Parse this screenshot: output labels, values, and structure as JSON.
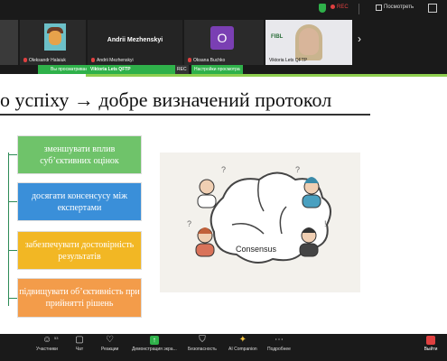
{
  "top_bar": {
    "rec_label": "REC",
    "view_label": "Посмотреть"
  },
  "participants": [
    {
      "name": "Oleksandr Halaiuk"
    },
    {
      "name": "Andrii Mezhenskyi",
      "display_name": "Andrii Mezhenskyi"
    },
    {
      "name": "Oksana Buchko",
      "initial": "O"
    },
    {
      "name": "Viktoria Lets QFTP",
      "logo_text": "FIBL"
    }
  ],
  "share_bar": {
    "notice": "Вы просматриваете экран",
    "presenter": "Viktoria Lets QFTP",
    "rec": "REC",
    "settings": "Настройки просмотра"
  },
  "slide": {
    "title": "о успіху → добре визначений протокол",
    "boxes": [
      "зменшувати вплив суб’єктивних оцінок",
      "досягати консенсусу між експертами",
      "забезпечувати достовірність результатів",
      "підвищувати об’єктивність при прийнятті рішень"
    ],
    "illustration_caption": "Consensus"
  },
  "toolbar": {
    "participants_label": "Участники",
    "participants_count": "53",
    "chat_label": "Чат",
    "reactions_label": "Реакции",
    "share_label": "Демонстрация экра...",
    "security_label": "Безопасность",
    "ai_label": "AI Companion",
    "more_label": "Подробнее",
    "exit_label": "Выйти"
  },
  "colors": {
    "accent_green": "#2fb14a",
    "box_green": "#6fc36a",
    "box_blue": "#3a8fd9",
    "box_yellow": "#f2b724",
    "box_orange": "#f39c4a",
    "exit_red": "#e04040"
  }
}
